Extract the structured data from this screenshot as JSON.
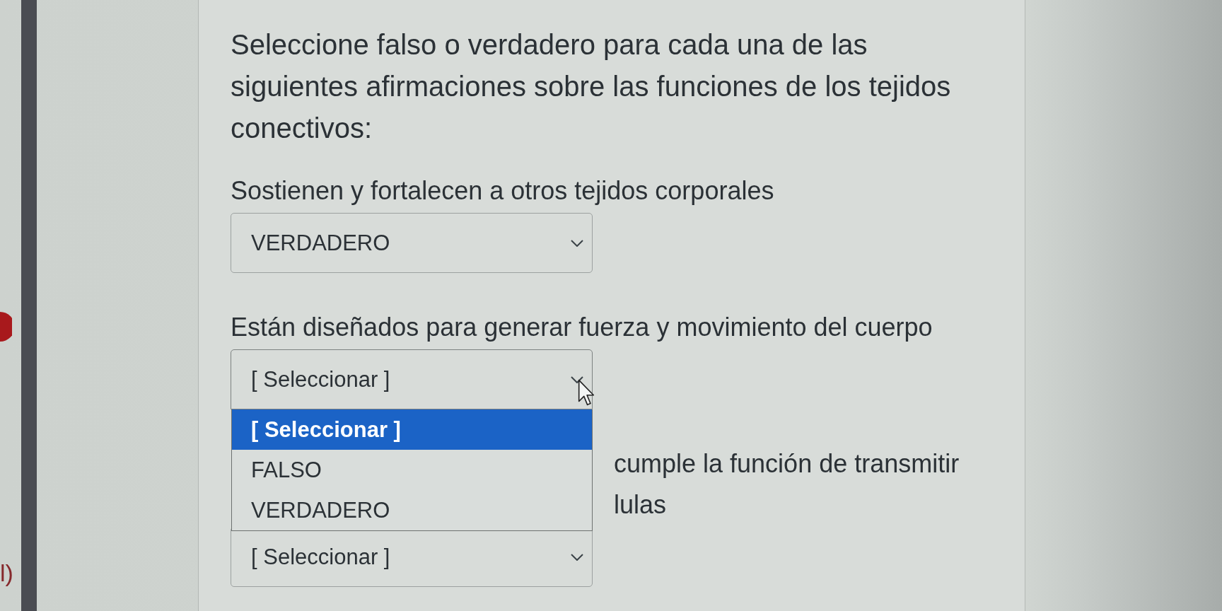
{
  "left_strip": {
    "label": "l)"
  },
  "question": {
    "prompt": "Seleccione falso o verdadero para cada una de las siguientes afirmaciones sobre las funciones de los tejidos conectivos:",
    "items": [
      {
        "statement_lines": [
          "Sostienen y fortalecen a otros tejidos corporales"
        ],
        "select": {
          "value": "VERDADERO",
          "expanded": false
        }
      },
      {
        "statement_lines": [
          "Están diseñados para generar fuerza y movimiento del cuerpo"
        ],
        "select": {
          "value": "[ Seleccionar ]",
          "expanded": true,
          "options": [
            {
              "label": "[ Seleccionar ]",
              "selected": true
            },
            {
              "label": "FALSO",
              "selected": false
            },
            {
              "label": "VERDADERO",
              "selected": false
            }
          ]
        }
      },
      {
        "statement_lines": [
          "cumple la función de transmitir",
          "lulas"
        ],
        "select": {
          "value": "[ Seleccionar ]",
          "expanded": false
        }
      }
    ]
  }
}
